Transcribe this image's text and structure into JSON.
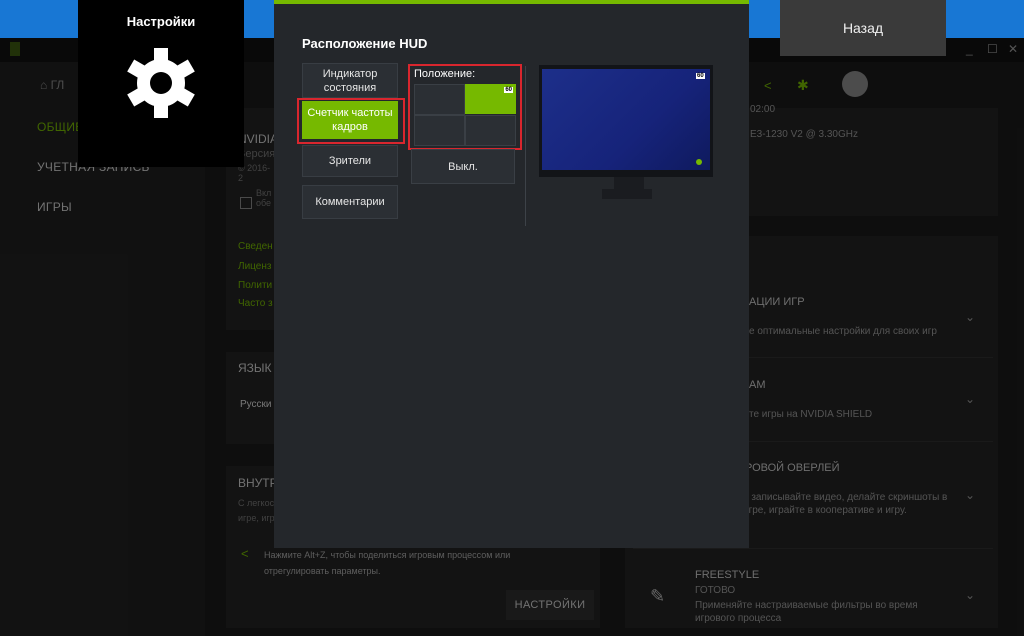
{
  "window": {
    "minimize_glyph": "_",
    "maximize_glyph": "☐",
    "close_glyph": "✕"
  },
  "nav": {
    "home_partial": "ГЛ",
    "items": [
      "ОБЩИЕ",
      "УЧЕТНАЯ ЗАПИСЬ",
      "ИГРЫ"
    ],
    "active_index": 0
  },
  "background": {
    "about_title_partial": "NVIDIA",
    "version_partial": "Версия",
    "copyright_partial": "© 2016-2",
    "checkbox_text_partial": "Вкл\nобе",
    "links_partial": [
      "Сведен",
      "Лиценз",
      "Полити",
      "Часто з"
    ],
    "language_title_partial": "ЯЗЫК",
    "language_value_partial": "Русски",
    "ingame_title_partial": "ВНУТР",
    "ingame_desc_partial": "С легкос\nигре, игр",
    "ingame_desc2_partial": "игре, игр",
    "share_hint": "Нажмите Alt+Z, чтобы поделиться игровым процессом или отрегулировать параметры.",
    "settings_button": "НАСТРОЙКИ",
    "sysinfo_time_partial": "02:00",
    "sysinfo_cpu_partial": "E3-1230 V2 @ 3.30GHz",
    "features": [
      {
        "title": "АЦИИ ИГР",
        "desc": "е оптимальные настройки для своих игр"
      },
      {
        "title": "AM",
        "desc": "те игры на NVIDIA SHIELD"
      },
      {
        "title": "РОВОЙ ОВЕРЛЕЙ",
        "desc": "о записывайте видео, делайте скриншоты в игре, играйте в кооперативе и игру."
      },
      {
        "title": "FREESTYLE",
        "status": "ГОТОВО",
        "desc": "Применяйте настраиваемые фильтры во время игрового процесса"
      }
    ]
  },
  "settings_badge": {
    "title": "Настройки",
    "icon": "gear-icon"
  },
  "back_button": "Назад",
  "hud_dialog": {
    "title": "Расположение HUD",
    "options": [
      "Индикатор состояния",
      "Счетчик частоты кадров",
      "Зрители",
      "Комментарии"
    ],
    "selected_option_index": 1,
    "position_label": "Положение:",
    "selected_cell": "top-right",
    "fps_badge": "60",
    "off_button": "Выкл.",
    "preview_fps_badge": "60"
  },
  "colors": {
    "accent": "#76b900",
    "highlight": "#d9262e",
    "dialog_bg": "#24272b"
  }
}
